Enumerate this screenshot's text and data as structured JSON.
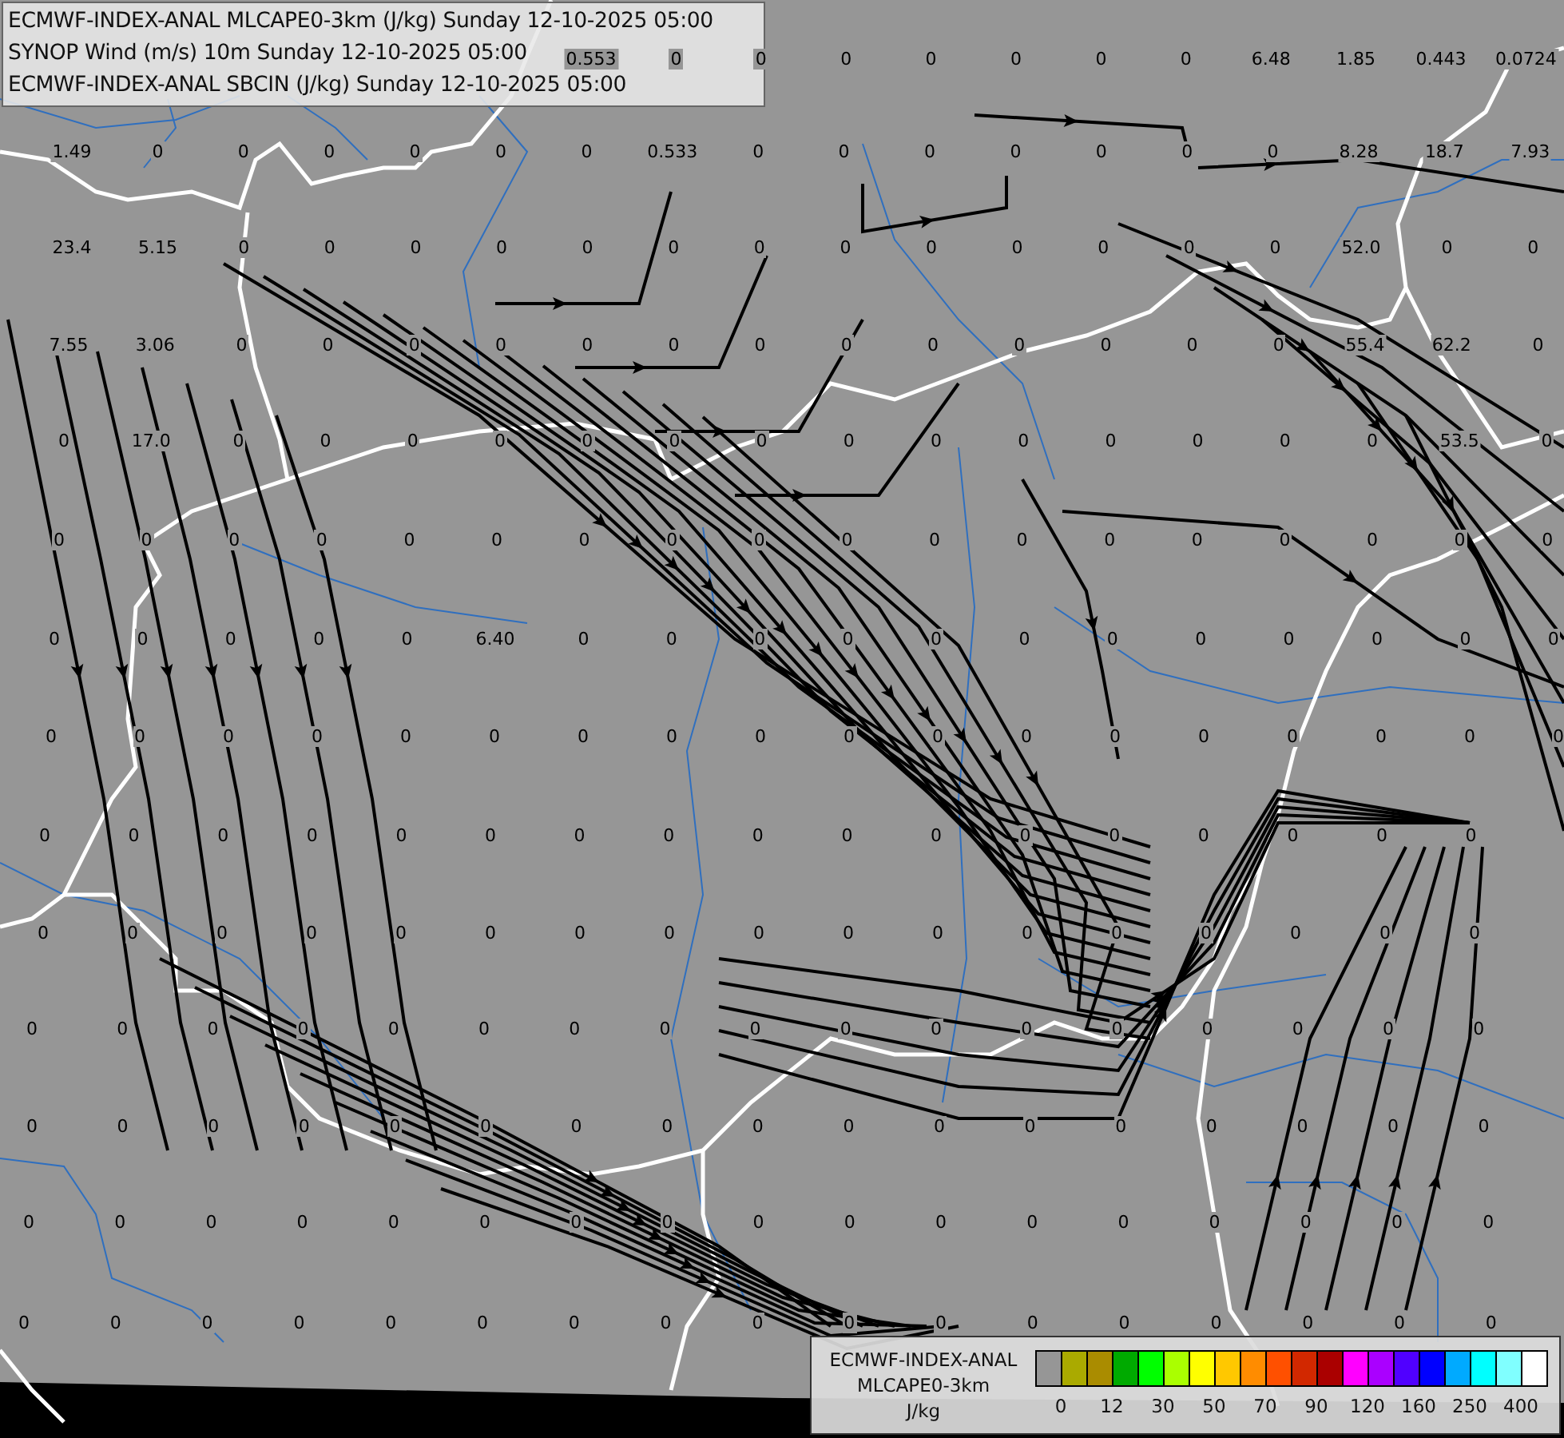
{
  "title_box": {
    "lines": [
      "ECMWF-INDEX-ANAL MLCAPE0-3km (J/kg) Sunday 12-10-2025 05:00",
      "SYNOP Wind (m/s) 10m Sunday 12-10-2025 05:00",
      "ECMWF-INDEX-ANAL SBCIN (J/kg) Sunday 12-10-2025 05:00"
    ]
  },
  "cape_value_rows": [
    [
      "0.553",
      "0",
      "0",
      "0",
      "0",
      "0",
      "0",
      "0",
      "6.48",
      "1.85",
      "0.443",
      "0.0724"
    ],
    [
      "1.49",
      "0",
      "0",
      "0",
      "0",
      "0",
      "0",
      "0.533",
      "0",
      "0",
      "0",
      "0",
      "0",
      "0",
      "0",
      "8.28",
      "18.7",
      "7.93"
    ],
    [
      "23.4",
      "5.15",
      "0",
      "0",
      "0",
      "0",
      "0",
      "0",
      "0",
      "0",
      "0",
      "0",
      "0",
      "0",
      "0",
      "52.0",
      "0",
      "0"
    ],
    [
      "7.55",
      "3.06",
      "0",
      "0",
      "0",
      "0",
      "0",
      "0",
      "0",
      "0",
      "0",
      "0",
      "0",
      "0",
      "0",
      "55.4",
      "62.2",
      "0"
    ],
    [
      "0",
      "17.0",
      "0",
      "0",
      "0",
      "0",
      "0",
      "0",
      "0",
      "0",
      "0",
      "0",
      "0",
      "0",
      "0",
      "0",
      "53.5",
      "0"
    ],
    [
      "0",
      "0",
      "0",
      "0",
      "0",
      "0",
      "0",
      "0",
      "0",
      "0",
      "0",
      "0",
      "0",
      "0",
      "0",
      "0",
      "0",
      "0"
    ],
    [
      "0",
      "0",
      "0",
      "0",
      "0",
      "6.40",
      "0",
      "0",
      "0",
      "0",
      "0",
      "0",
      "0",
      "0",
      "0",
      "0",
      "0",
      "0"
    ],
    [
      "0",
      "0",
      "0",
      "0",
      "0",
      "0",
      "0",
      "0",
      "0",
      "0",
      "0",
      "0",
      "0",
      "0",
      "0",
      "0",
      "0",
      "0"
    ],
    [
      "0",
      "0",
      "0",
      "0",
      "0",
      "0",
      "0",
      "0",
      "0",
      "0",
      "0",
      "0",
      "0",
      "0",
      "0",
      "0",
      "0"
    ],
    [
      "0",
      "0",
      "0",
      "0",
      "0",
      "0",
      "0",
      "0",
      "0",
      "0",
      "0",
      "0",
      "0",
      "0",
      "0",
      "0",
      "0"
    ],
    [
      "0",
      "0",
      "0",
      "0",
      "0",
      "0",
      "0",
      "0",
      "0",
      "0",
      "0",
      "0",
      "0",
      "0",
      "0",
      "0",
      "0"
    ],
    [
      "0",
      "0",
      "0",
      "0",
      "0",
      "0",
      "0",
      "0",
      "0",
      "0",
      "0",
      "0",
      "0",
      "0",
      "0",
      "0",
      "0"
    ],
    [
      "0",
      "0",
      "0",
      "0",
      "0",
      "0",
      "0",
      "0",
      "0",
      "0",
      "0",
      "0",
      "0",
      "0",
      "0",
      "0",
      "0"
    ],
    [
      "0",
      "0",
      "0",
      "0",
      "0",
      "0",
      "0",
      "0",
      "0",
      "0",
      "0",
      "0",
      "0",
      "0",
      "0",
      "0",
      "0"
    ]
  ],
  "legend": {
    "title_lines": [
      "ECMWF-INDEX-ANAL",
      "MLCAPE0-3km",
      "J/kg"
    ],
    "swatches": [
      {
        "color": "#969696"
      },
      {
        "color": "#aaaa00"
      },
      {
        "color": "#aa8c00"
      },
      {
        "color": "#00aa00"
      },
      {
        "color": "#00ff00"
      },
      {
        "color": "#aaff00"
      },
      {
        "color": "#ffff00"
      },
      {
        "color": "#ffc800"
      },
      {
        "color": "#ff8c00"
      },
      {
        "color": "#ff5000"
      },
      {
        "color": "#d22800"
      },
      {
        "color": "#aa0000"
      },
      {
        "color": "#ff00ff"
      },
      {
        "color": "#aa00ff"
      },
      {
        "color": "#5000ff"
      },
      {
        "color": "#0000ff"
      },
      {
        "color": "#00aaff"
      },
      {
        "color": "#00ffff"
      },
      {
        "color": "#80ffff"
      },
      {
        "color": "#ffffff"
      }
    ],
    "ticks": [
      "0",
      "12",
      "30",
      "50",
      "70",
      "90",
      "120",
      "160",
      "250",
      "400"
    ]
  }
}
